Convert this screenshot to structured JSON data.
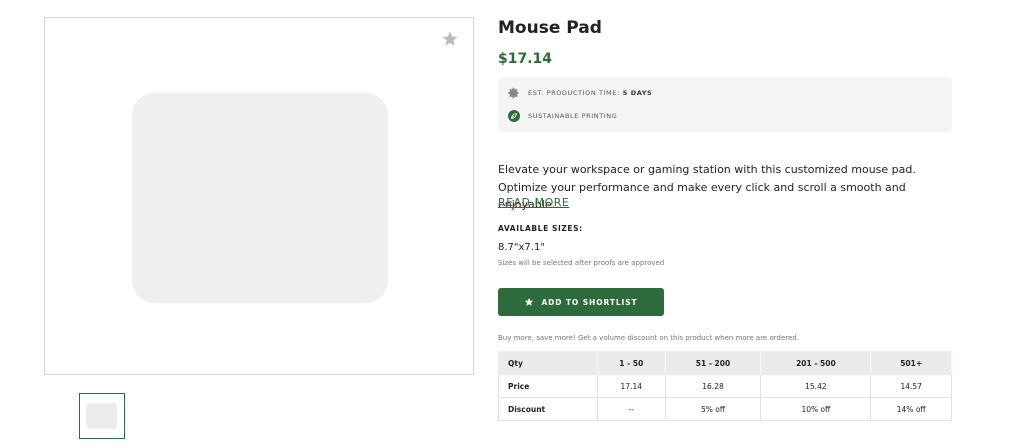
{
  "product": {
    "title": "Mouse Pad",
    "price": "$17.14"
  },
  "info": {
    "production_label": "EST. PRODUCTION TIME:",
    "production_value": "5 DAYS",
    "production_icon": "gear-icon",
    "sustainable_label": "SUSTAINABLE PRINTING",
    "sustainable_icon": "leaf-icon"
  },
  "description": {
    "text": "Elevate your workspace or gaming station with this customized mouse pad. Optimize your performance and make every click and scroll a smooth and enjoyable…",
    "read_more": "READ MORE"
  },
  "sizes": {
    "label": "AVAILABLE SIZES:",
    "value": "8.7\"x7.1\"",
    "note": "Sizes will be selected after proofs are approved"
  },
  "shortlist": {
    "label": "ADD TO SHORTLIST",
    "icon": "star-icon"
  },
  "volume": {
    "note": "Buy more, save more! Get a volume discount on this product when more are ordered.",
    "header": [
      "Qty",
      "1 - 50",
      "51 - 200",
      "201 - 500",
      "501+"
    ],
    "price_row": [
      "Price",
      "17.14",
      "16.28",
      "15.42",
      "14.57"
    ],
    "discount_row": [
      "Discount",
      "--",
      "5% off",
      "10% off",
      "14% off"
    ]
  },
  "colors": {
    "brand_green": "#2e6b3a",
    "info_bg": "#f4f4f4",
    "table_header_bg": "#e9ece9"
  }
}
